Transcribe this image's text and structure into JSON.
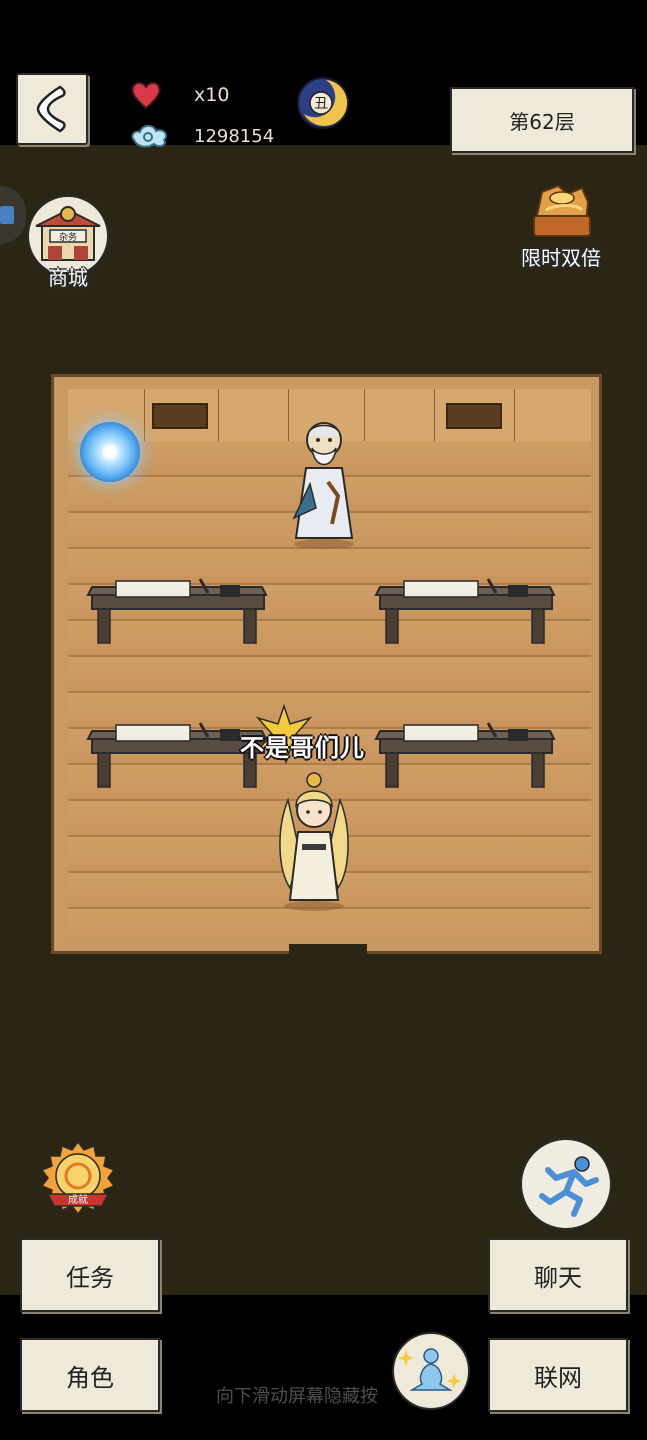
{
  "hud": {
    "lives": "x10",
    "spirit": "1298154",
    "time_badge_char": "丑",
    "floor_label": "第62层"
  },
  "shop": {
    "label": "商城",
    "sign_text": "杂务"
  },
  "double_reward": {
    "label": "限时双倍"
  },
  "scene": {
    "speech_text": "不是哥们儿"
  },
  "achievement": {
    "label": "成就"
  },
  "menu": {
    "task_label": "任务",
    "chat_label": "聊天",
    "role_label": "角色",
    "network_label": "联网"
  },
  "hint": {
    "text": "向下滑动屏幕隐藏按"
  },
  "colors": {
    "paper": "#efe9d9",
    "background": "#2b2514",
    "floor_wood": "#c8955d",
    "heart": "#d9394a",
    "portal": "#5fb4f2"
  }
}
